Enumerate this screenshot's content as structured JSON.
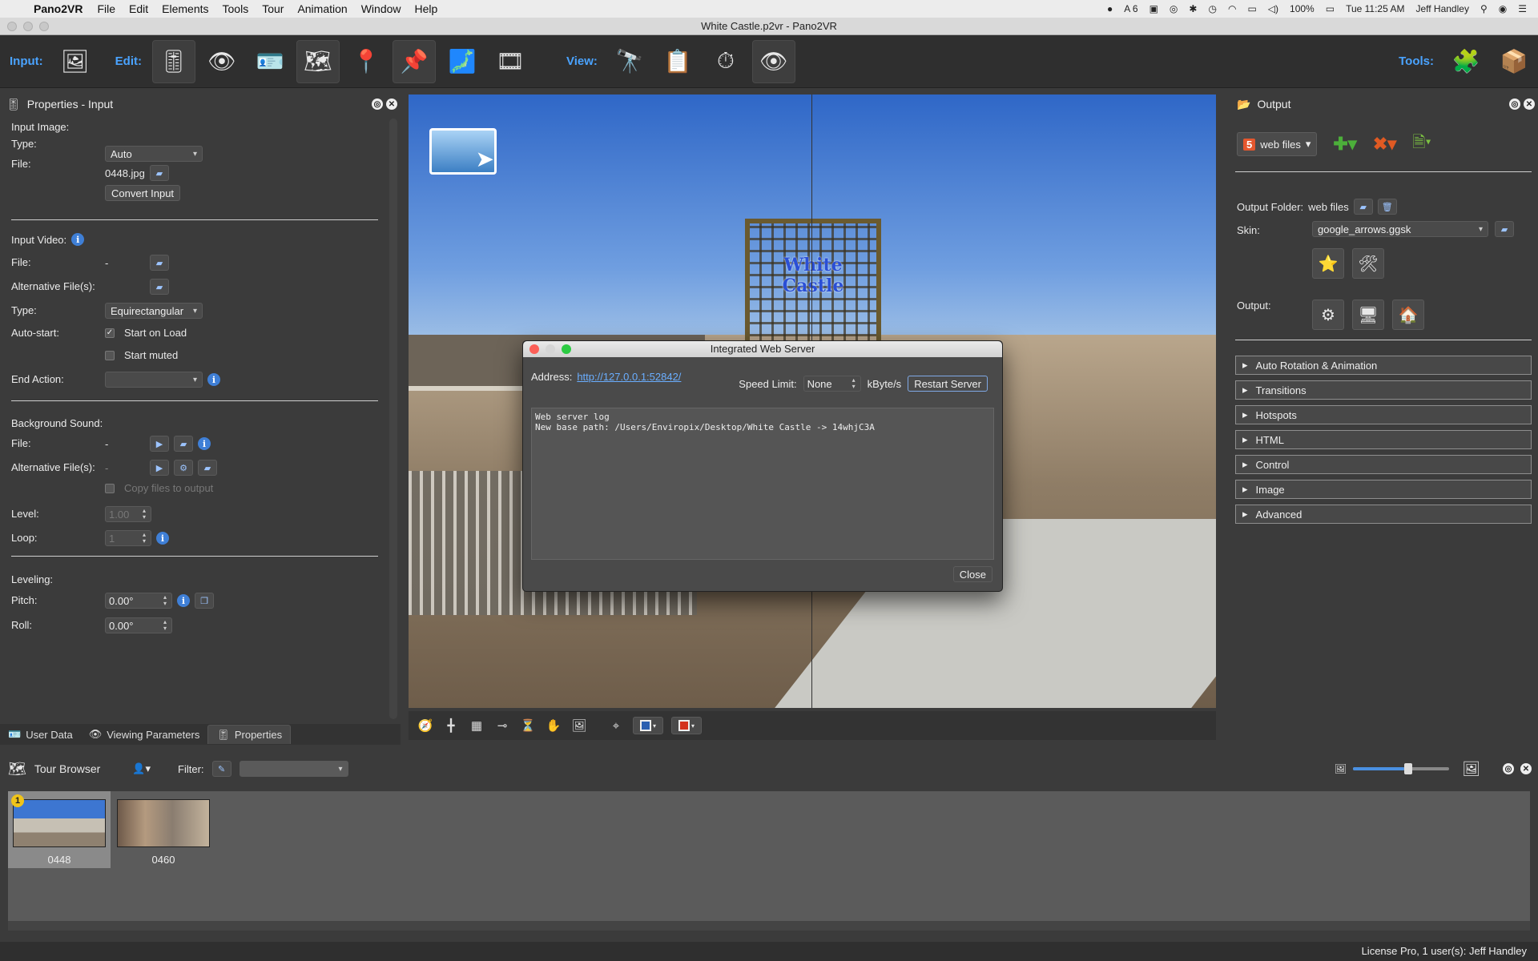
{
  "menubar": {
    "app_name": "Pano2VR",
    "menus": [
      "File",
      "Edit",
      "Elements",
      "Tools",
      "Tour",
      "Animation",
      "Window",
      "Help"
    ],
    "status": {
      "badge": "6",
      "battery": "100%",
      "time": "Tue 11:25 AM",
      "user": "Jeff Handley"
    }
  },
  "window": {
    "title": "White Castle.p2vr - Pano2VR"
  },
  "toolbar": {
    "input_label": "Input:",
    "edit_label": "Edit:",
    "view_label": "View:",
    "tools_label": "Tools:"
  },
  "left_panel": {
    "title": "Properties - Input",
    "input_image": {
      "section": "Input Image:",
      "type_label": "Type:",
      "type_value": "Auto",
      "file_label": "File:",
      "file_value": "0448.jpg",
      "convert_button": "Convert Input"
    },
    "input_video": {
      "section": "Input Video:",
      "file_label": "File:",
      "file_value": "-",
      "alt_label": "Alternative File(s):",
      "type_label": "Type:",
      "type_value": "Equirectangular",
      "autostart_label": "Auto-start:",
      "start_on_load": "Start on Load",
      "start_muted": "Start muted",
      "end_action_label": "End Action:"
    },
    "background_sound": {
      "section": "Background Sound:",
      "file_label": "File:",
      "file_value": "-",
      "alt_label": "Alternative File(s):",
      "alt_value": "-",
      "copy_files": "Copy files to output",
      "level_label": "Level:",
      "level_value": "1.00",
      "loop_label": "Loop:",
      "loop_value": "1"
    },
    "leveling": {
      "section": "Leveling:",
      "pitch_label": "Pitch:",
      "pitch_value": "0.00°",
      "roll_label": "Roll:",
      "roll_value": "0.00°"
    },
    "tabs": [
      "User Data",
      "Viewing Parameters",
      "Properties"
    ]
  },
  "viewer": {
    "sign_text": "White Castle"
  },
  "dialog": {
    "title": "Integrated Web Server",
    "address_label": "Address:",
    "address_url": "http://127.0.0.1:52842/",
    "speed_label": "Speed Limit:",
    "speed_value": "None",
    "speed_unit": "kByte/s",
    "restart_button": "Restart Server",
    "log_line1": "Web server log",
    "log_line2": "New base path: /Users/Enviropix/Desktop/White Castle -> 14whjC3A",
    "close_button": "Close"
  },
  "right_panel": {
    "title": "Output",
    "format_button": "web files",
    "output_folder_label": "Output Folder:",
    "output_folder_value": "web files",
    "skin_label": "Skin:",
    "skin_value": "google_arrows.ggsk",
    "output_label": "Output:",
    "sections": [
      "Auto Rotation & Animation",
      "Transitions",
      "Hotspots",
      "HTML",
      "Control",
      "Image",
      "Advanced"
    ]
  },
  "tour_browser": {
    "title": "Tour Browser",
    "filter_label": "Filter:",
    "thumbnails": [
      {
        "label": "0448",
        "badge": "1"
      },
      {
        "label": "0460"
      }
    ]
  },
  "status_bar": {
    "text": "License Pro, 1 user(s): Jeff Handley"
  }
}
